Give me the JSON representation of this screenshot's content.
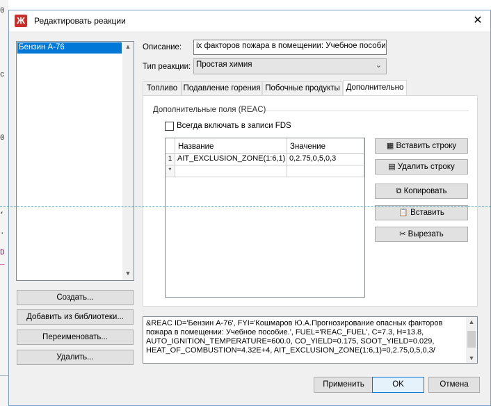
{
  "background": {
    "left_chars": [
      "0",
      "c",
      "0",
      ",",
      ".",
      "D",
      "_"
    ]
  },
  "dialog": {
    "title": "Редактировать реакции",
    "app_icon": "fire-reaction-icon",
    "close_glyph": "✕"
  },
  "reactions_list": {
    "items": [
      "Бензин А-76"
    ],
    "selected_index": 0
  },
  "left_buttons": {
    "create": "Создать...",
    "add_from_library": "Добавить из библиотеки...",
    "rename": "Переименовать...",
    "delete": "Удалить..."
  },
  "form": {
    "description_label": "Описание:",
    "description_value": "іх факторов пожара в помещении: Учебное пособие.",
    "reaction_type_label": "Тип реакции:",
    "reaction_type_value": "Простая химия"
  },
  "tabs": [
    {
      "label": "Топливо",
      "active": false
    },
    {
      "label": "Подавление горения",
      "active": false
    },
    {
      "label": "Побочные продукты",
      "active": false
    },
    {
      "label": "Дополнительно",
      "active": true
    }
  ],
  "additional": {
    "group_label": "Дополнительные поля (REAC)",
    "always_include_label": "Всегда включать в записи FDS",
    "always_include_checked": false,
    "table": {
      "headers": [
        "Название",
        "Значение"
      ],
      "rows": [
        {
          "num": "1",
          "name": "AIT_EXCLUSION_ZONE(1:6,1)",
          "value": "0,2.75,0,5,0,3"
        },
        {
          "num": "*",
          "name": "",
          "value": ""
        }
      ]
    },
    "buttons": {
      "insert_row": "Вставить строку",
      "delete_row": "Удалить строку",
      "copy": "Копировать",
      "paste": "Вставить",
      "cut": "Вырезать"
    }
  },
  "preview_lines": [
    "&REAC ID='Бензин А-76', FYI='Кошмаров Ю.А.Прогнозирование опасных факторов",
    "пожара в помещении: Учебное пособие.', FUEL='REAC_FUEL', C=7.3, H=13.8,",
    "AUTO_IGNITION_TEMPERATURE=600.0, CO_YIELD=0.175, SOOT_YIELD=0.029,",
    "HEAT_OF_COMBUSTION=4.32E+4, AIT_EXCLUSION_ZONE(1:6,1)=0,2.75,0,5,0,3/"
  ],
  "footer": {
    "apply": "Применить",
    "ok": "OK",
    "cancel": "Отмена"
  },
  "colors": {
    "selection": "#0078d7",
    "window_bg": "#f0f0f0",
    "title_icon": "#c9302c"
  }
}
